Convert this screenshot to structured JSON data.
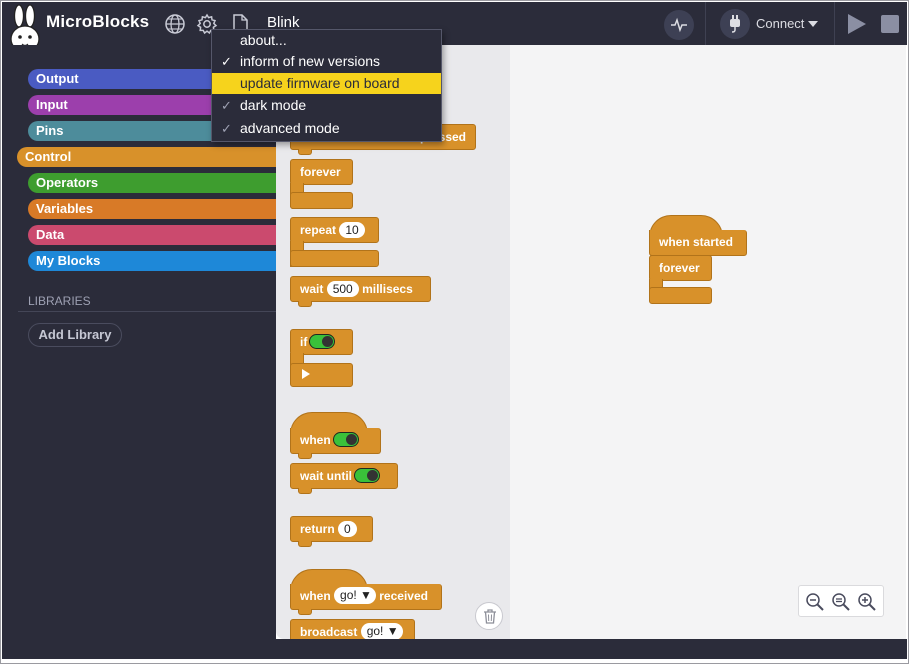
{
  "app": {
    "name": "MicroBlocks",
    "project_name": "Blink"
  },
  "toolbar": {
    "globe_icon": "globe-icon",
    "settings_icon": "gear-icon",
    "file_icon": "file-icon",
    "graph_icon": "graph-icon",
    "connect_label": "Connect",
    "run_icon": "play-icon",
    "stop_icon": "stop-icon"
  },
  "settings_menu": {
    "items": [
      {
        "label": "about...",
        "checked": false
      },
      {
        "label": "inform of new versions",
        "checked": true
      },
      {
        "label": "update firmware on board",
        "checked": false,
        "highlighted": true
      },
      {
        "label": "dark mode",
        "checked": true
      },
      {
        "label": "advanced mode",
        "checked": true
      }
    ]
  },
  "categories": [
    {
      "label": "Output",
      "color": "#4a5bc2"
    },
    {
      "label": "Input",
      "color": "#9c3fac"
    },
    {
      "label": "Pins",
      "color": "#4d8c9b"
    },
    {
      "label": "Control",
      "color": "#d8912a",
      "selected": true
    },
    {
      "label": "Operators",
      "color": "#3e9d2f"
    },
    {
      "label": "Variables",
      "color": "#d87a27"
    },
    {
      "label": "Data",
      "color": "#cb4a6e"
    },
    {
      "label": "My Blocks",
      "color": "#1e88d8"
    }
  ],
  "libraries": {
    "title": "LIBRARIES",
    "add_label": "Add Library"
  },
  "palette": {
    "pressed_partial": "pressed",
    "forever": "forever",
    "repeat": "repeat",
    "repeat_count": "10",
    "wait": "wait",
    "wait_value": "500",
    "millisecs": "millisecs",
    "if": "if",
    "when": "when",
    "wait_until": "wait until",
    "return": "return",
    "return_value": "0",
    "when_msg": "when",
    "msg_value": "go!",
    "received": "received",
    "broadcast": "broadcast",
    "broadcast_value": "go!"
  },
  "script": {
    "when_started": "when started",
    "forever": "forever"
  },
  "zoom": {
    "out_icon": "zoom-out-icon",
    "reset_icon": "zoom-reset-icon",
    "in_icon": "zoom-in-icon"
  },
  "trash_icon": "trash-icon"
}
